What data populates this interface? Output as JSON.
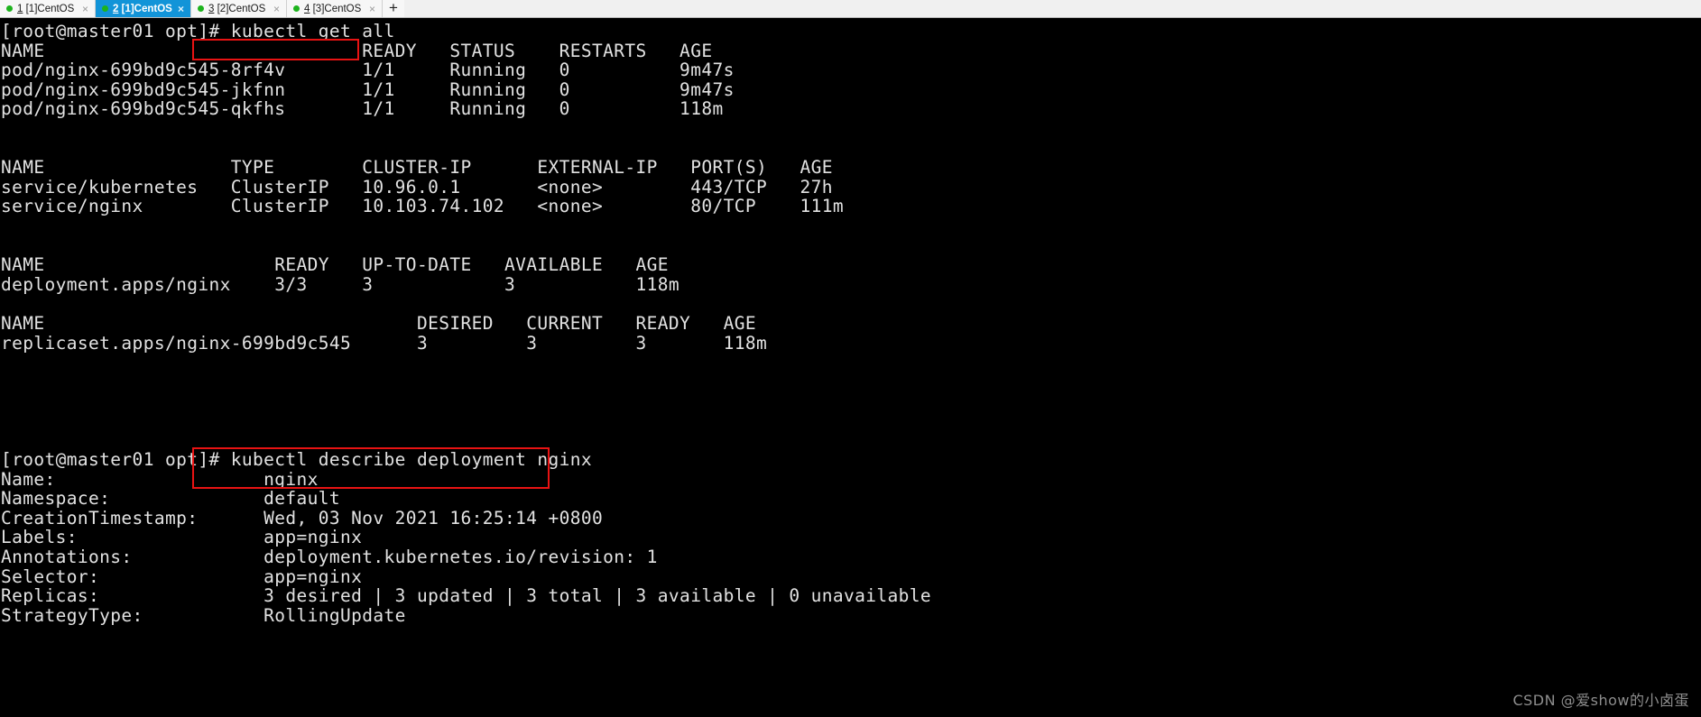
{
  "window": {
    "tabs": [
      {
        "index": "1",
        "label": "[1]CentOS",
        "active": false,
        "indicator": "green-dot",
        "close_label": "×"
      },
      {
        "index": "2",
        "label": "[1]CentOS",
        "active": true,
        "indicator": "green-dot",
        "close_label": "×"
      },
      {
        "index": "3",
        "label": "[2]CentOS",
        "active": false,
        "indicator": "green-dot",
        "close_label": "×"
      },
      {
        "index": "4",
        "label": "[3]CentOS",
        "active": false,
        "indicator": "green-dot",
        "close_label": "×"
      }
    ],
    "new_tab_label": "+"
  },
  "terminal": {
    "prompt": "[root@master01 opt]# ",
    "commands": {
      "first": "kubectl get all",
      "second": "kubectl describe deployment nginx"
    },
    "lines": [
      "[root@master01 opt]# kubectl get all",
      "NAME                             READY   STATUS    RESTARTS   AGE",
      "pod/nginx-699bd9c545-8rf4v       1/1     Running   0          9m47s",
      "pod/nginx-699bd9c545-jkfnn       1/1     Running   0          9m47s",
      "pod/nginx-699bd9c545-qkfhs       1/1     Running   0          118m",
      "",
      "",
      "NAME                 TYPE        CLUSTER-IP      EXTERNAL-IP   PORT(S)   AGE",
      "service/kubernetes   ClusterIP   10.96.0.1       <none>        443/TCP   27h",
      "service/nginx        ClusterIP   10.103.74.102   <none>        80/TCP    111m",
      "",
      "",
      "NAME                     READY   UP-TO-DATE   AVAILABLE   AGE",
      "deployment.apps/nginx    3/3     3            3           118m",
      "",
      "NAME                                  DESIRED   CURRENT   READY   AGE",
      "replicaset.apps/nginx-699bd9c545      3         3         3       118m",
      "",
      "",
      "",
      "",
      "",
      "[root@master01 opt]# kubectl describe deployment nginx",
      "Name:                   nginx",
      "Namespace:              default",
      "CreationTimestamp:      Wed, 03 Nov 2021 16:25:14 +0800",
      "Labels:                 app=nginx",
      "Annotations:            deployment.kubernetes.io/revision: 1",
      "Selector:               app=nginx",
      "Replicas:               3 desired | 3 updated | 3 total | 3 available | 0 unavailable",
      "StrategyType:           RollingUpdate"
    ],
    "highlight_color": "#e81313",
    "background_color": "#000000",
    "foreground_color": "#e2e2e2"
  },
  "watermark": {
    "text": "CSDN @爱show的小卤蛋"
  }
}
